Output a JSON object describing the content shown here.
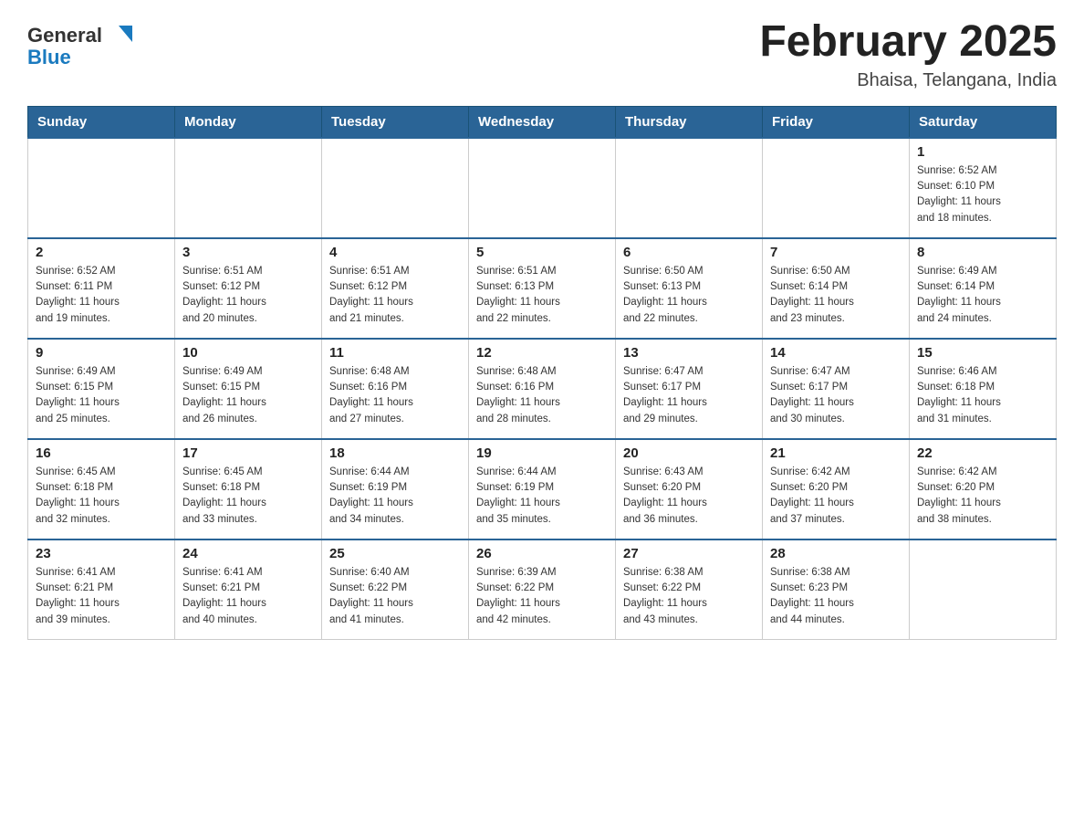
{
  "header": {
    "logo_general": "General",
    "logo_blue": "Blue",
    "month_title": "February 2025",
    "location": "Bhaisa, Telangana, India"
  },
  "weekdays": [
    "Sunday",
    "Monday",
    "Tuesday",
    "Wednesday",
    "Thursday",
    "Friday",
    "Saturday"
  ],
  "weeks": [
    [
      {
        "day": "",
        "info": ""
      },
      {
        "day": "",
        "info": ""
      },
      {
        "day": "",
        "info": ""
      },
      {
        "day": "",
        "info": ""
      },
      {
        "day": "",
        "info": ""
      },
      {
        "day": "",
        "info": ""
      },
      {
        "day": "1",
        "info": "Sunrise: 6:52 AM\nSunset: 6:10 PM\nDaylight: 11 hours\nand 18 minutes."
      }
    ],
    [
      {
        "day": "2",
        "info": "Sunrise: 6:52 AM\nSunset: 6:11 PM\nDaylight: 11 hours\nand 19 minutes."
      },
      {
        "day": "3",
        "info": "Sunrise: 6:51 AM\nSunset: 6:12 PM\nDaylight: 11 hours\nand 20 minutes."
      },
      {
        "day": "4",
        "info": "Sunrise: 6:51 AM\nSunset: 6:12 PM\nDaylight: 11 hours\nand 21 minutes."
      },
      {
        "day": "5",
        "info": "Sunrise: 6:51 AM\nSunset: 6:13 PM\nDaylight: 11 hours\nand 22 minutes."
      },
      {
        "day": "6",
        "info": "Sunrise: 6:50 AM\nSunset: 6:13 PM\nDaylight: 11 hours\nand 22 minutes."
      },
      {
        "day": "7",
        "info": "Sunrise: 6:50 AM\nSunset: 6:14 PM\nDaylight: 11 hours\nand 23 minutes."
      },
      {
        "day": "8",
        "info": "Sunrise: 6:49 AM\nSunset: 6:14 PM\nDaylight: 11 hours\nand 24 minutes."
      }
    ],
    [
      {
        "day": "9",
        "info": "Sunrise: 6:49 AM\nSunset: 6:15 PM\nDaylight: 11 hours\nand 25 minutes."
      },
      {
        "day": "10",
        "info": "Sunrise: 6:49 AM\nSunset: 6:15 PM\nDaylight: 11 hours\nand 26 minutes."
      },
      {
        "day": "11",
        "info": "Sunrise: 6:48 AM\nSunset: 6:16 PM\nDaylight: 11 hours\nand 27 minutes."
      },
      {
        "day": "12",
        "info": "Sunrise: 6:48 AM\nSunset: 6:16 PM\nDaylight: 11 hours\nand 28 minutes."
      },
      {
        "day": "13",
        "info": "Sunrise: 6:47 AM\nSunset: 6:17 PM\nDaylight: 11 hours\nand 29 minutes."
      },
      {
        "day": "14",
        "info": "Sunrise: 6:47 AM\nSunset: 6:17 PM\nDaylight: 11 hours\nand 30 minutes."
      },
      {
        "day": "15",
        "info": "Sunrise: 6:46 AM\nSunset: 6:18 PM\nDaylight: 11 hours\nand 31 minutes."
      }
    ],
    [
      {
        "day": "16",
        "info": "Sunrise: 6:45 AM\nSunset: 6:18 PM\nDaylight: 11 hours\nand 32 minutes."
      },
      {
        "day": "17",
        "info": "Sunrise: 6:45 AM\nSunset: 6:18 PM\nDaylight: 11 hours\nand 33 minutes."
      },
      {
        "day": "18",
        "info": "Sunrise: 6:44 AM\nSunset: 6:19 PM\nDaylight: 11 hours\nand 34 minutes."
      },
      {
        "day": "19",
        "info": "Sunrise: 6:44 AM\nSunset: 6:19 PM\nDaylight: 11 hours\nand 35 minutes."
      },
      {
        "day": "20",
        "info": "Sunrise: 6:43 AM\nSunset: 6:20 PM\nDaylight: 11 hours\nand 36 minutes."
      },
      {
        "day": "21",
        "info": "Sunrise: 6:42 AM\nSunset: 6:20 PM\nDaylight: 11 hours\nand 37 minutes."
      },
      {
        "day": "22",
        "info": "Sunrise: 6:42 AM\nSunset: 6:20 PM\nDaylight: 11 hours\nand 38 minutes."
      }
    ],
    [
      {
        "day": "23",
        "info": "Sunrise: 6:41 AM\nSunset: 6:21 PM\nDaylight: 11 hours\nand 39 minutes."
      },
      {
        "day": "24",
        "info": "Sunrise: 6:41 AM\nSunset: 6:21 PM\nDaylight: 11 hours\nand 40 minutes."
      },
      {
        "day": "25",
        "info": "Sunrise: 6:40 AM\nSunset: 6:22 PM\nDaylight: 11 hours\nand 41 minutes."
      },
      {
        "day": "26",
        "info": "Sunrise: 6:39 AM\nSunset: 6:22 PM\nDaylight: 11 hours\nand 42 minutes."
      },
      {
        "day": "27",
        "info": "Sunrise: 6:38 AM\nSunset: 6:22 PM\nDaylight: 11 hours\nand 43 minutes."
      },
      {
        "day": "28",
        "info": "Sunrise: 6:38 AM\nSunset: 6:23 PM\nDaylight: 11 hours\nand 44 minutes."
      },
      {
        "day": "",
        "info": ""
      }
    ]
  ]
}
